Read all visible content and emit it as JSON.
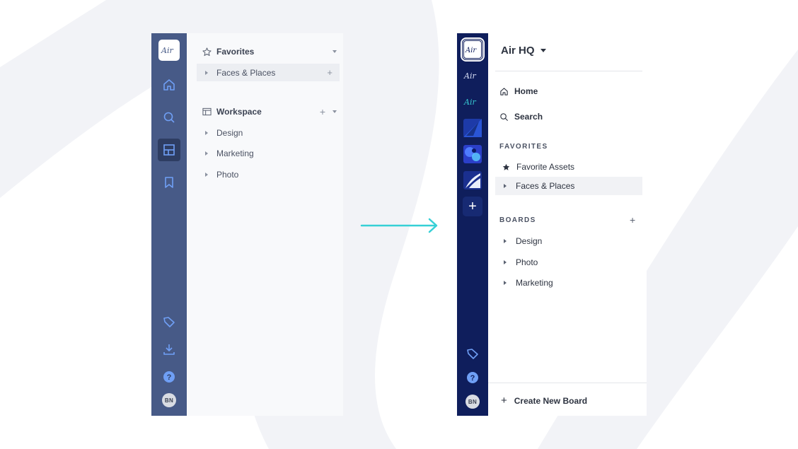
{
  "colors": {
    "old_rail": "#475a87",
    "old_panel": "#f8f9fb",
    "new_rail": "#0f1e5c",
    "arrow": "#36d0d6",
    "icon_blue": "#6f9ff5"
  },
  "before": {
    "logo_text": "Air",
    "rail_icons": [
      "home-icon",
      "search-icon",
      "layout-icon",
      "bookmark-icon"
    ],
    "bottom_icons": [
      "tag-icon",
      "download-icon",
      "help-icon"
    ],
    "avatar": "BN",
    "favorites": {
      "title": "Favorites",
      "items": [
        "Faces & Places"
      ]
    },
    "workspace": {
      "title": "Workspace",
      "items": [
        "Design",
        "Marketing",
        "Photo"
      ]
    }
  },
  "after": {
    "workspace_name": "Air HQ",
    "workspaces": [
      "Air",
      "Air",
      "Air"
    ],
    "add_workspace": "+",
    "avatar": "BN",
    "nav": {
      "home": "Home",
      "search": "Search"
    },
    "favorites": {
      "label": "FAVORITES",
      "items": [
        "Favorite Assets",
        "Faces & Places"
      ]
    },
    "boards": {
      "label": "BOARDS",
      "add": "+",
      "items": [
        "Design",
        "Photo",
        "Marketing"
      ]
    },
    "create_board": "Create New Board"
  }
}
